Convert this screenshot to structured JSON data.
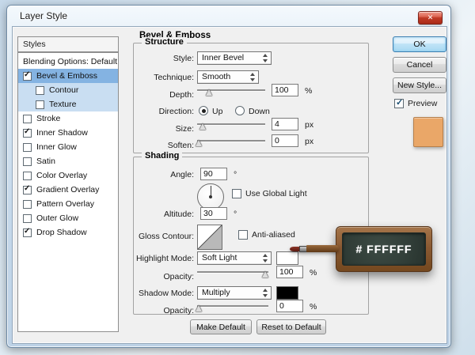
{
  "window": {
    "title": "Layer Style"
  },
  "icons": {
    "close": "✕",
    "check": "✓"
  },
  "sidebar": {
    "header": "Styles",
    "items": [
      {
        "label": "Blending Options: Default",
        "check": ""
      },
      {
        "label": "Bevel & Emboss",
        "check": "✓"
      },
      {
        "label": "Contour",
        "check": ""
      },
      {
        "label": "Texture",
        "check": ""
      },
      {
        "label": "Stroke",
        "check": ""
      },
      {
        "label": "Inner Shadow",
        "check": "✓"
      },
      {
        "label": "Inner Glow",
        "check": ""
      },
      {
        "label": "Satin",
        "check": ""
      },
      {
        "label": "Color Overlay",
        "check": ""
      },
      {
        "label": "Gradient Overlay",
        "check": "✓"
      },
      {
        "label": "Pattern Overlay",
        "check": ""
      },
      {
        "label": "Outer Glow",
        "check": ""
      },
      {
        "label": "Drop Shadow",
        "check": "✓"
      }
    ]
  },
  "main": {
    "title": "Bevel & Emboss",
    "structure": {
      "legend": "Structure",
      "style_label": "Style:",
      "style_value": "Inner Bevel",
      "technique_label": "Technique:",
      "technique_value": "Smooth",
      "depth_label": "Depth:",
      "depth_value": "100",
      "depth_unit": "%",
      "direction_label": "Direction:",
      "direction_up": "Up",
      "direction_down": "Down",
      "size_label": "Size:",
      "size_value": "4",
      "size_unit": "px",
      "soften_label": "Soften:",
      "soften_value": "0",
      "soften_unit": "px"
    },
    "shading": {
      "legend": "Shading",
      "angle_label": "Angle:",
      "angle_value": "90",
      "angle_unit": "°",
      "use_global_light_label": "Use Global Light",
      "use_global_light_check": "",
      "altitude_label": "Altitude:",
      "altitude_value": "30",
      "altitude_unit": "°",
      "gloss_contour_label": "Gloss Contour:",
      "anti_aliased_label": "Anti-aliased",
      "anti_aliased_check": "",
      "highlight_mode_label": "Highlight Mode:",
      "highlight_mode_value": "Soft Light",
      "highlight_opacity_label": "Opacity:",
      "highlight_opacity_value": "100",
      "highlight_opacity_unit": "%",
      "shadow_mode_label": "Shadow Mode:",
      "shadow_mode_value": "Multiply",
      "shadow_opacity_label": "Opacity:",
      "shadow_opacity_value": "0",
      "shadow_opacity_unit": "%"
    },
    "footer": {
      "make_default": "Make Default",
      "reset_to_default": "Reset to Default"
    }
  },
  "actions": {
    "ok": "OK",
    "cancel": "Cancel",
    "new_style": "New Style...",
    "preview_label": "Preview",
    "preview_check": "✓"
  },
  "overlay": {
    "chalkboard_text": "# FFFFFF"
  },
  "colors": {
    "highlight_swatch": "#ffffff",
    "shadow_swatch": "#000000",
    "preview_swatch": "#eaa768",
    "selection_blue": "#84b3e2",
    "sub_selection_blue": "#c9def2",
    "chalkboard_green": "#33413a",
    "frame_brown": "#8a5a33"
  }
}
